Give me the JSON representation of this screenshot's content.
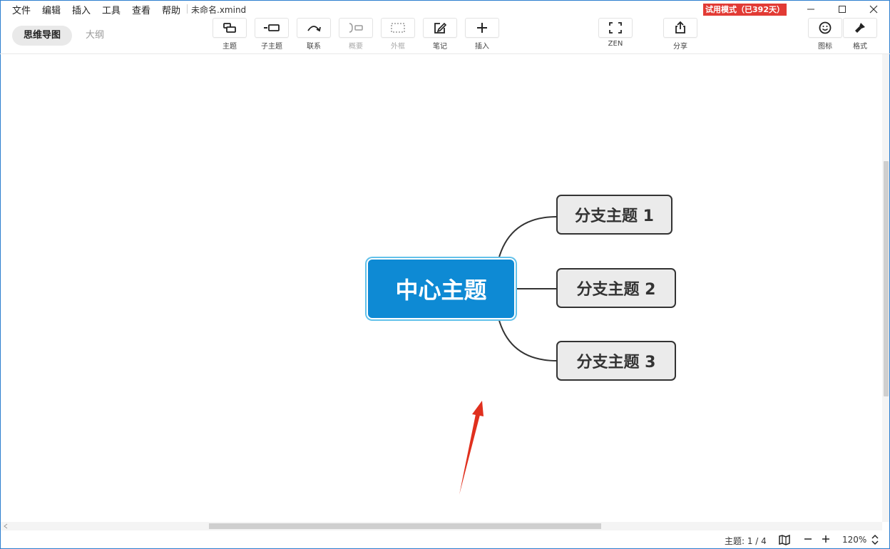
{
  "menu": {
    "items": [
      "文件",
      "编辑",
      "插入",
      "工具",
      "查看",
      "帮助"
    ],
    "doc_title": "未命名.xmind"
  },
  "trial_badge": "试用模式（已392天）",
  "view_tabs": {
    "mindmap": "思维导图",
    "outline": "大纲"
  },
  "toolbar": {
    "topic": "主题",
    "subtopic": "子主题",
    "relationship": "联系",
    "summary": "概要",
    "boundary": "外框",
    "note": "笔记",
    "insert": "插入",
    "zen": "ZEN",
    "share": "分享",
    "icon": "图标",
    "format": "格式"
  },
  "mindmap": {
    "central_topic": "中心主题",
    "branches": [
      "分支主题 1",
      "分支主题 2",
      "分支主题 3"
    ]
  },
  "status": {
    "topic_count": "主题: 1 / 4",
    "zoom": "120%"
  },
  "colors": {
    "central_fill": "#0e8ad4",
    "central_outline": "#62c1ea",
    "branch_fill": "#ebebeb",
    "trial_badge": "#e23b35",
    "annotation_arrow": "#e0301e"
  }
}
